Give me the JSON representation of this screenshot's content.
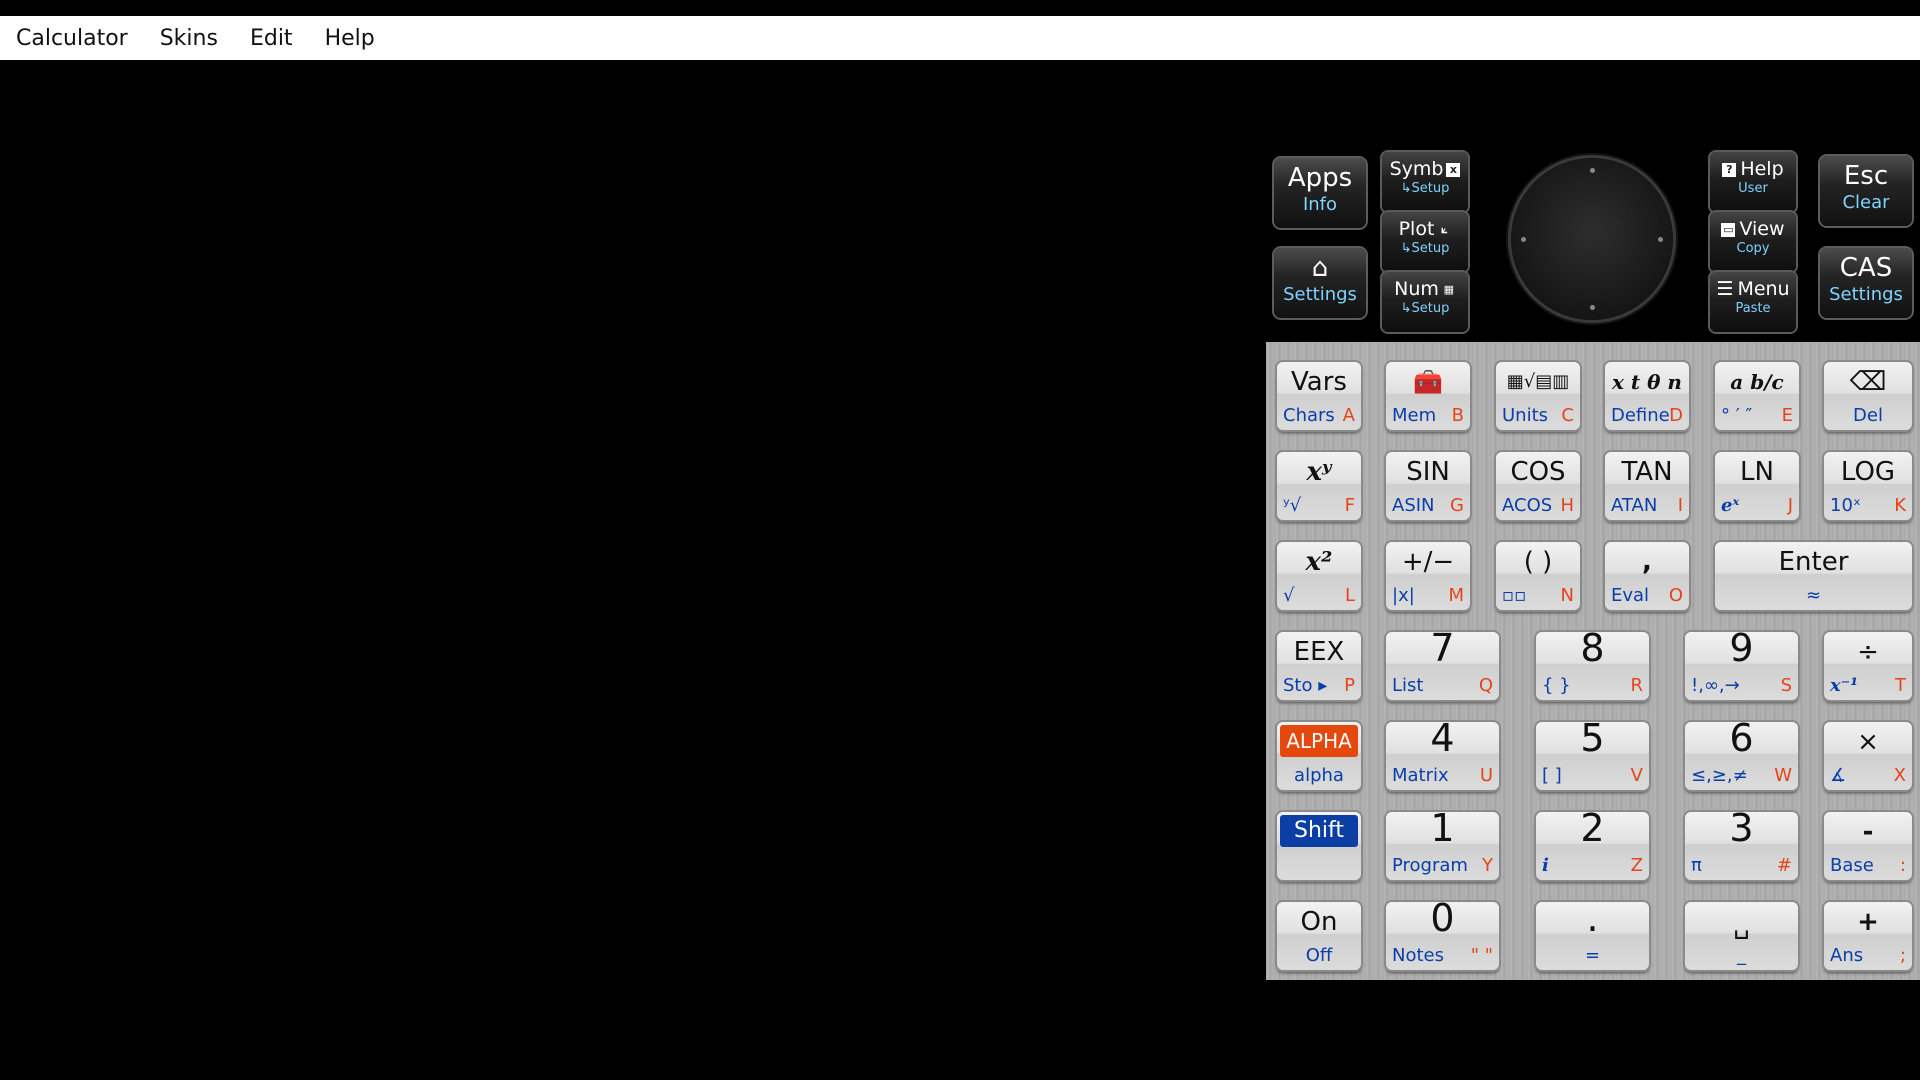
{
  "menu": [
    "Calculator",
    "Skins",
    "Edit",
    "Help"
  ],
  "top_keys": {
    "apps": {
      "main": "Apps",
      "sub": "Info"
    },
    "home": {
      "main": "⌂",
      "sub": "Settings"
    },
    "symb": {
      "main": "Symb",
      "sub": "↳Setup"
    },
    "plot": {
      "main": "Plot",
      "sub": "↳Setup"
    },
    "num": {
      "main": "Num",
      "sub": "↳Setup"
    },
    "help": {
      "main": "Help",
      "sub": "User"
    },
    "view": {
      "main": "View",
      "sub": "Copy"
    },
    "menu": {
      "main": "Menu",
      "sub": "Paste"
    },
    "esc": {
      "main": "Esc",
      "sub": "Clear"
    },
    "cas": {
      "main": "CAS",
      "sub": "Settings"
    }
  },
  "keys": {
    "vars": {
      "main": "Vars",
      "sub": "Chars",
      "alpha": "A"
    },
    "mem": {
      "main": "🧰",
      "sub": "Mem",
      "alpha": "B"
    },
    "units": {
      "main": "▦√▤▥",
      "sub": "Units",
      "alpha": "C"
    },
    "xtn": {
      "main": "x t θ n",
      "sub": "Define",
      "alpha": "D"
    },
    "frac": {
      "main": "a b/c",
      "sub": "° ′ ″",
      "alpha": "E"
    },
    "del": {
      "main": "⌫",
      "sub": "Del"
    },
    "xpow": {
      "main": "xʸ",
      "sub": "ʸ√",
      "alpha": "F"
    },
    "sin": {
      "main": "SIN",
      "sub": "ASIN",
      "alpha": "G"
    },
    "cos": {
      "main": "COS",
      "sub": "ACOS",
      "alpha": "H"
    },
    "tan": {
      "main": "TAN",
      "sub": "ATAN",
      "alpha": "I"
    },
    "ln": {
      "main": "LN",
      "sub": "eˣ",
      "alpha": "J"
    },
    "log": {
      "main": "LOG",
      "sub": "10ˣ",
      "alpha": "K"
    },
    "xsq": {
      "main": "x²",
      "sub": "√",
      "alpha": "L"
    },
    "neg": {
      "main": "+/−",
      "sub": "|x|",
      "alpha": "M"
    },
    "paren": {
      "main": "( )",
      "sub": "▫▫",
      "alpha": "N"
    },
    "comma": {
      "main": ",",
      "sub": "Eval",
      "alpha": "O"
    },
    "enter": {
      "main": "Enter",
      "sub": "≈"
    },
    "eex": {
      "main": "EEX",
      "sub": "Sto ▸",
      "alpha": "P"
    },
    "k7": {
      "main": "7",
      "sub": "List",
      "alpha": "Q"
    },
    "k8": {
      "main": "8",
      "sub": "{ }",
      "alpha": "R"
    },
    "k9": {
      "main": "9",
      "sub": "!,∞,→",
      "alpha": "S"
    },
    "div": {
      "main": "÷",
      "sub": "x⁻¹",
      "alpha": "T"
    },
    "alphak": {
      "main": "ALPHA",
      "sub": "alpha"
    },
    "k4": {
      "main": "4",
      "sub": "Matrix",
      "alpha": "U"
    },
    "k5": {
      "main": "5",
      "sub": "[ ]",
      "alpha": "V"
    },
    "k6": {
      "main": "6",
      "sub": "≤,≥,≠",
      "alpha": "W"
    },
    "mul": {
      "main": "×",
      "sub": "∡",
      "alpha": "X"
    },
    "shift": {
      "main": "Shift"
    },
    "k1": {
      "main": "1",
      "sub": "Program",
      "alpha": "Y"
    },
    "k2": {
      "main": "2",
      "sub": "i",
      "alpha": "Z"
    },
    "k3": {
      "main": "3",
      "sub": "π",
      "alpha": "#"
    },
    "sub": {
      "main": "-",
      "sub": "Base",
      "alpha": ":"
    },
    "on": {
      "main": "On",
      "sub": "Off"
    },
    "k0": {
      "main": "0",
      "sub": "Notes",
      "alpha": "\" \""
    },
    "dot": {
      "main": ".",
      "sub": "="
    },
    "space": {
      "main": "␣",
      "sub": "_"
    },
    "add": {
      "main": "+",
      "sub": "Ans",
      "alpha": ";"
    }
  }
}
